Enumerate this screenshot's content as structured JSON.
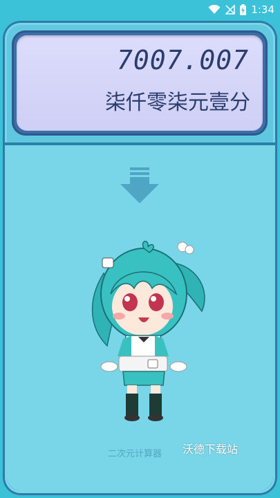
{
  "status_bar": {
    "time": "1:34",
    "icons": [
      "wifi-icon",
      "signal-off-icon",
      "battery-charging-icon"
    ]
  },
  "display": {
    "number": "7007.007",
    "words": "柒仟零柒元壹分"
  },
  "hint_icon": "down-arrow-icon",
  "footer": {
    "label": "二次元计算器",
    "watermark": "沃德下载站"
  },
  "colors": {
    "body": "#3cc2d8",
    "display_bg": "#d6d6f8",
    "display_text": "#2a3d6e",
    "panel_border": "#3d6ea7"
  }
}
